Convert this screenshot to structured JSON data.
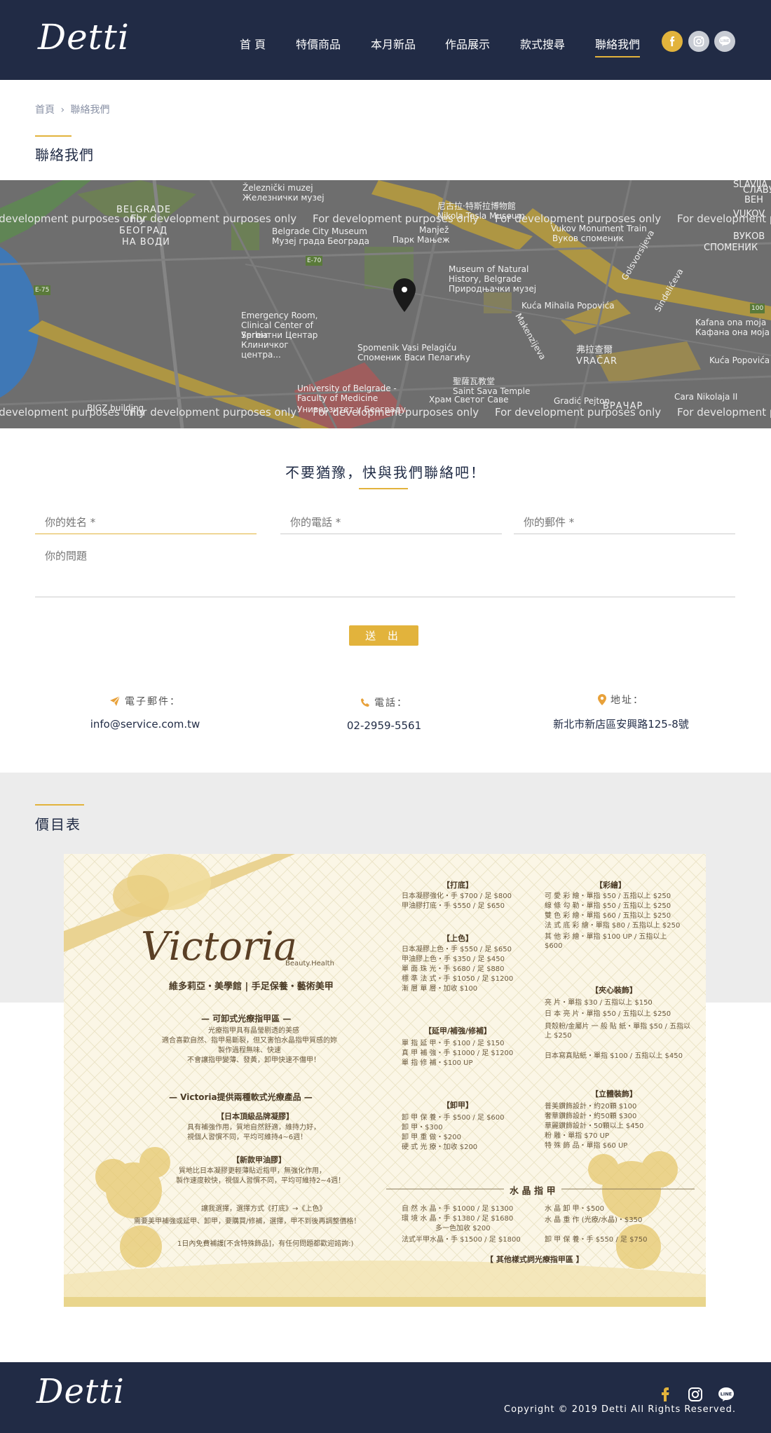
{
  "header": {
    "logo": "Detti",
    "nav": [
      "首 頁",
      "特價商品",
      "本月新品",
      "作品展示",
      "款式搜尋",
      "聯絡我們"
    ],
    "active_index": 5,
    "social": [
      "facebook-icon",
      "instagram-icon",
      "line-icon"
    ],
    "colors": {
      "bg": "#212b45",
      "accent": "#e2b33c",
      "social_gray": "#c8ccd4"
    }
  },
  "breadcrumb": [
    "首頁",
    "聯絡我們"
  ],
  "page_title": "聯絡我們",
  "map": {
    "watermark": "For development purposes only",
    "labels": [
      "Železnički muzej",
      "Железнички музеј",
      "尼古拉·特斯拉博物館",
      "Nikola Tesla Museum",
      "BELGRADE",
      "БЕОГРАД",
      "НА ВОДИ",
      "Belgrade City Museum",
      "Музеј града Београда",
      "Manjež",
      "Парк Мањеж",
      "Vukov Monument Train",
      "Вуков споменик",
      "SLAVIJA",
      "СЛАВУЈ",
      "ВЕН",
      "VUKOV",
      "ВУКОВ",
      "СПОМЕНИК",
      "Museum of Natural History, Belgrade",
      "Природњачки музеј",
      "Kuća Mihaila Popovića",
      "Emergency Room, Clinical Center of Serbia",
      "Ургентни Центар Клиничког центра...",
      "Spomenik Vasi Pelagiću",
      "Споменик Васи Пелагићу",
      "弗拉查爾",
      "VRAČAR",
      "ВРАЧАР",
      "聖薩瓦教堂",
      "Saint Sava Temple",
      "Храм Светог Саве",
      "University of Belgrade - Faculty of Medicine",
      "Универзитет у Београду",
      "Gradić Pejton",
      "Kafana ona moja",
      "Кафана она моја",
      "Kuća Popovića",
      "Cara Nikolaja II",
      "BIGZ building",
      "Golsvorsijeva",
      "Sindelićeva",
      "Makenzijeva",
      "E-75",
      "E-70",
      "100"
    ]
  },
  "form": {
    "heading": "不要猶豫，快與我們聯絡吧！",
    "name_placeholder": "你的姓名 *",
    "phone_placeholder": "你的電話 *",
    "email_placeholder": "你的郵件 *",
    "question_placeholder": "你的問題",
    "submit": "送 出"
  },
  "contact_info": [
    {
      "icon": "paper-plane-icon",
      "label": "電子郵件：",
      "value": "info@service.com.tw"
    },
    {
      "icon": "phone-icon",
      "label": "電話：",
      "value": "02-2959-5561"
    },
    {
      "icon": "location-pin-icon",
      "label": "地址：",
      "value": "新北市新店區安興路125-8號"
    }
  ],
  "price_list": {
    "title": "價目表",
    "brand": "Victoria",
    "brand_sub": "Beauty.Health",
    "tagline": "維多莉亞・美學館 | 手足保養・藝術美甲",
    "sections": [
      {
        "head": "【打底】",
        "rows": [
          "日本凝膠強化・手 $700 / 足 $800",
          "甲油膠打底・手 $550 / 足 $650"
        ]
      },
      {
        "head": "【上色】",
        "rows": [
          "日本凝膠上色・手 $550 / 足 $650",
          "甲油膠上色・手 $350 / 足 $450",
          "單 面 珠 光・手 $680 / 足 $880",
          "標 準 法 式・手 $1050 / 足 $1200",
          "漸 層 單 層・加收 $100"
        ]
      },
      {
        "head": "【延甲/補強/修補】",
        "rows": [
          "單 指 延 甲・手 $100 / 足 $150",
          "真 甲 補 強・手 $1000 / 足 $1200",
          "單 指 修 補・$100 UP"
        ]
      },
      {
        "head": "【卸甲】",
        "rows": [
          "卸 甲 保 養・手 $500 / 足 $600",
          "卸 甲・$300",
          "卸 甲 重 做・$200",
          "硬 式 光 療・加收 $200"
        ]
      },
      {
        "head": "【彩繪】",
        "rows": [
          "可 愛 彩 繪・單指 $50 / 五指以上 $250",
          "線 條 勾 勒・單指 $50 / 五指以上 $250",
          "雙 色 彩 繪・單指 $60 / 五指以上 $250",
          "法 式 底 彩 繪・單指 $80 / 五指以上 $250",
          "其 他 彩 繪・單指 $100 UP / 五指以上 $600"
        ]
      },
      {
        "head": "【夾心裝飾】",
        "rows": [
          "亮 片・單指 $30 / 五指以上 $150",
          "日 本 亮 片・單指 $50 / 五指以上 $250",
          "貝殼粉/金屬片 一 般 貼 紙・單指 $50 / 五指以上 $250",
          "日本寫真貼紙・單指 $100 / 五指以上 $450"
        ]
      },
      {
        "head": "【立體裝飾】",
        "rows": [
          "普美鑽飾設計・約20顆 $100",
          "奢華鑽飾設計・約50顆 $300",
          "華麗鑽飾設計・50顆以上 $450",
          "粉 雕・單指 $70 UP",
          "特 殊 飾 品・單指 $60 UP"
        ]
      },
      {
        "head": "水 晶 指 甲",
        "rows": [
          "自 然 水 晶・手 $1000 / 足 $1300",
          "環 境 水 晶・手 $1380 / 足 $1680",
          "多一色加收 $200",
          "法式半甲水晶・手 $1500 / 足 $1800",
          "水 晶 卸 甲・$500",
          "水 晶 重 作 (光療/水晶)・$350",
          "卸 甲 保 養・手 $550 / 足 $750"
        ]
      }
    ],
    "notes": [
      "— 可卸式光療指甲區 —",
      "光療指甲具有晶瑩剔透的美感",
      "適合喜歡自然、指甲易斷裂，但又害怕水晶指甲質感的妳",
      "製作過程無味、快速",
      "不會讓指甲變薄、發黃，卸甲快速不傷甲！",
      "— Victoria提供兩種軟式光療產品 —",
      "【日本頂級品牌凝膠】",
      "具有補強作用，質地自然舒適，維持力好，",
      "視個人習慣不同，平均可維持4~6週！",
      "【新款甲油膠】",
      "質地比日本凝膠更輕薄貼近指甲，無強化作用，",
      "製作速度較快，視個人習慣不同，平均可維持2~4週！",
      "讓我選擇，選擇方式《打底》→《上色》",
      "需要美甲補強或延甲、卸甲，要購買/修補，選擇，甲不到後再調整價格！",
      "1日內免費補護[不含特殊飾品]，有任何問題都歡迎諮詢:)",
      "【 其他樣式詞光療指甲區 】"
    ]
  },
  "footer": {
    "logo": "Detti",
    "social": [
      "facebook-icon",
      "instagram-icon",
      "line-icon"
    ],
    "copyright": "Copyright © 2019 Detti All Rights Reserved."
  }
}
